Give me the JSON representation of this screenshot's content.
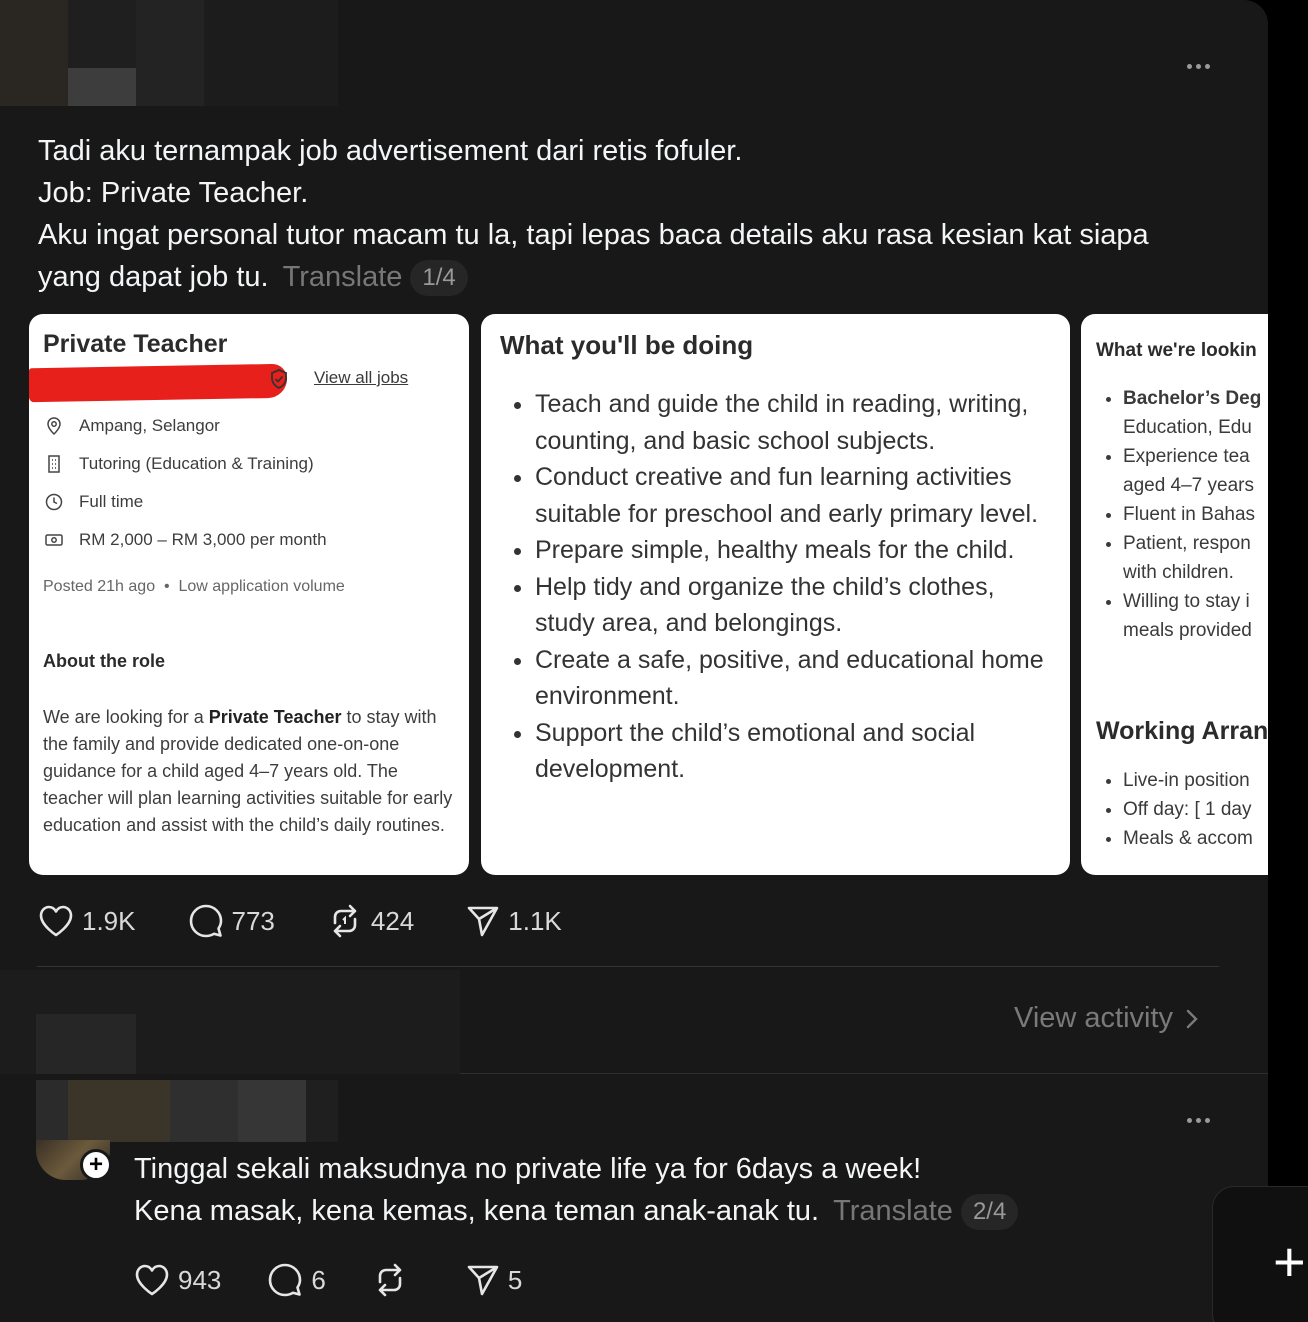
{
  "post": {
    "lines": [
      "Tadi aku ternampak job advertisement dari retis fofuler.",
      "Job: Private Teacher.",
      "Aku ingat personal tutor macam tu la, tapi lepas baca details aku rasa kesian kat siapa",
      "yang dapat job tu."
    ],
    "translate_label": "Translate",
    "page_indicator": "1/4",
    "likes": "1.9K",
    "comments": "773",
    "reposts": "424",
    "shares": "1.1K"
  },
  "card1": {
    "title": "Private Teacher",
    "view_all": "View all jobs",
    "location": "Ampang, Selangor",
    "category": "Tutoring (Education & Training)",
    "type": "Full time",
    "salary": "RM 2,000 – RM 3,000 per month",
    "posted": "Posted 21h ago",
    "volume": "Low application volume",
    "about_heading": "About the role",
    "about_pre": "We are looking for a ",
    "about_bold": "Private Teacher",
    "about_post": " to stay with the family and provide dedicated one-on-one guidance for a child aged 4–7 years old. The teacher will plan learning activities suitable for early education and assist with the child’s daily routines."
  },
  "card2": {
    "heading": "What you'll be doing",
    "bullets": [
      "Teach and guide the child in reading, writing, counting, and basic school subjects.",
      "Conduct creative and fun learning activities suitable for preschool and early primary level.",
      "Prepare simple, healthy meals for the child.",
      "Help tidy and organize the child’s clothes, study area, and belongings.",
      "Create a safe, positive, and educational home environment.",
      "Support the child’s emotional and social development."
    ]
  },
  "card3": {
    "heading": "What we're lookin",
    "bullets_a": [
      [
        "Bachelor’s Deg",
        "Education, Edu"
      ],
      [
        "Experience tea",
        "aged 4–7 years"
      ],
      [
        "Fluent in Bahas"
      ],
      [
        "Patient, respon",
        "with children."
      ],
      [
        "Willing to stay i",
        "meals provided"
      ]
    ],
    "heading2": "Working Arran",
    "bullets_b": [
      "Live-in position",
      "Off day: [ 1 day",
      "Meals & accom"
    ]
  },
  "view_activity": "View activity",
  "reply": {
    "line1": "Tinggal sekali maksudnya no private life ya for 6days a week!",
    "line2": "Kena masak, kena kemas, kena teman anak-anak tu.",
    "translate_label": "Translate",
    "page_indicator": "2/4",
    "likes": "943",
    "comments": "6",
    "shares": "5"
  },
  "icons": {
    "more": "more-horizontal-icon",
    "heart": "heart-icon",
    "comment": "comment-bubble-icon",
    "repost": "repost-icon",
    "share": "send-icon",
    "chevron": "chevron-right-icon",
    "plus": "plus-icon"
  }
}
